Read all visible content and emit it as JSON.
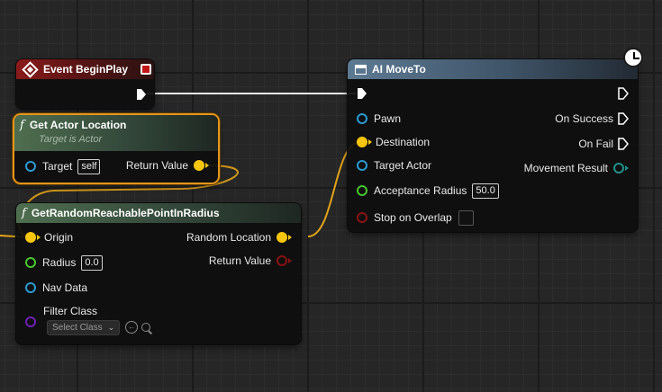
{
  "colors": {
    "exec": "#ffffff",
    "vector": "#f7c60f",
    "object": "#2a9ad3",
    "float": "#46c72a",
    "bool": "#8a1212",
    "class": "#6f1fb6",
    "struct": "#1f8f8a",
    "selection": "#e5961b"
  },
  "event_node": {
    "title": "Event BeginPlay",
    "icon": "event-diamond-icon"
  },
  "get_actor_location": {
    "title": "Get Actor Location",
    "subtitle": "Target is Actor",
    "fx": "f",
    "target_label": "Target",
    "target_value": "self",
    "return_label": "Return Value"
  },
  "random_point": {
    "title": "GetRandomReachablePointInRadius",
    "fx": "f",
    "origin_label": "Origin",
    "radius_label": "Radius",
    "radius_value": "0.0",
    "nav_data_label": "Nav Data",
    "filter_class_label": "Filter Class",
    "filter_class_placeholder": "Select Class",
    "random_location_label": "Random Location",
    "return_label": "Return Value"
  },
  "ai_moveto": {
    "title": "AI MoveTo",
    "pawn_label": "Pawn",
    "destination_label": "Destination",
    "target_actor_label": "Target Actor",
    "acceptance_radius_label": "Acceptance Radius",
    "acceptance_radius_value": "50.0",
    "stop_on_overlap_label": "Stop on Overlap",
    "on_success_label": "On Success",
    "on_fail_label": "On Fail",
    "movement_result_label": "Movement Result"
  }
}
